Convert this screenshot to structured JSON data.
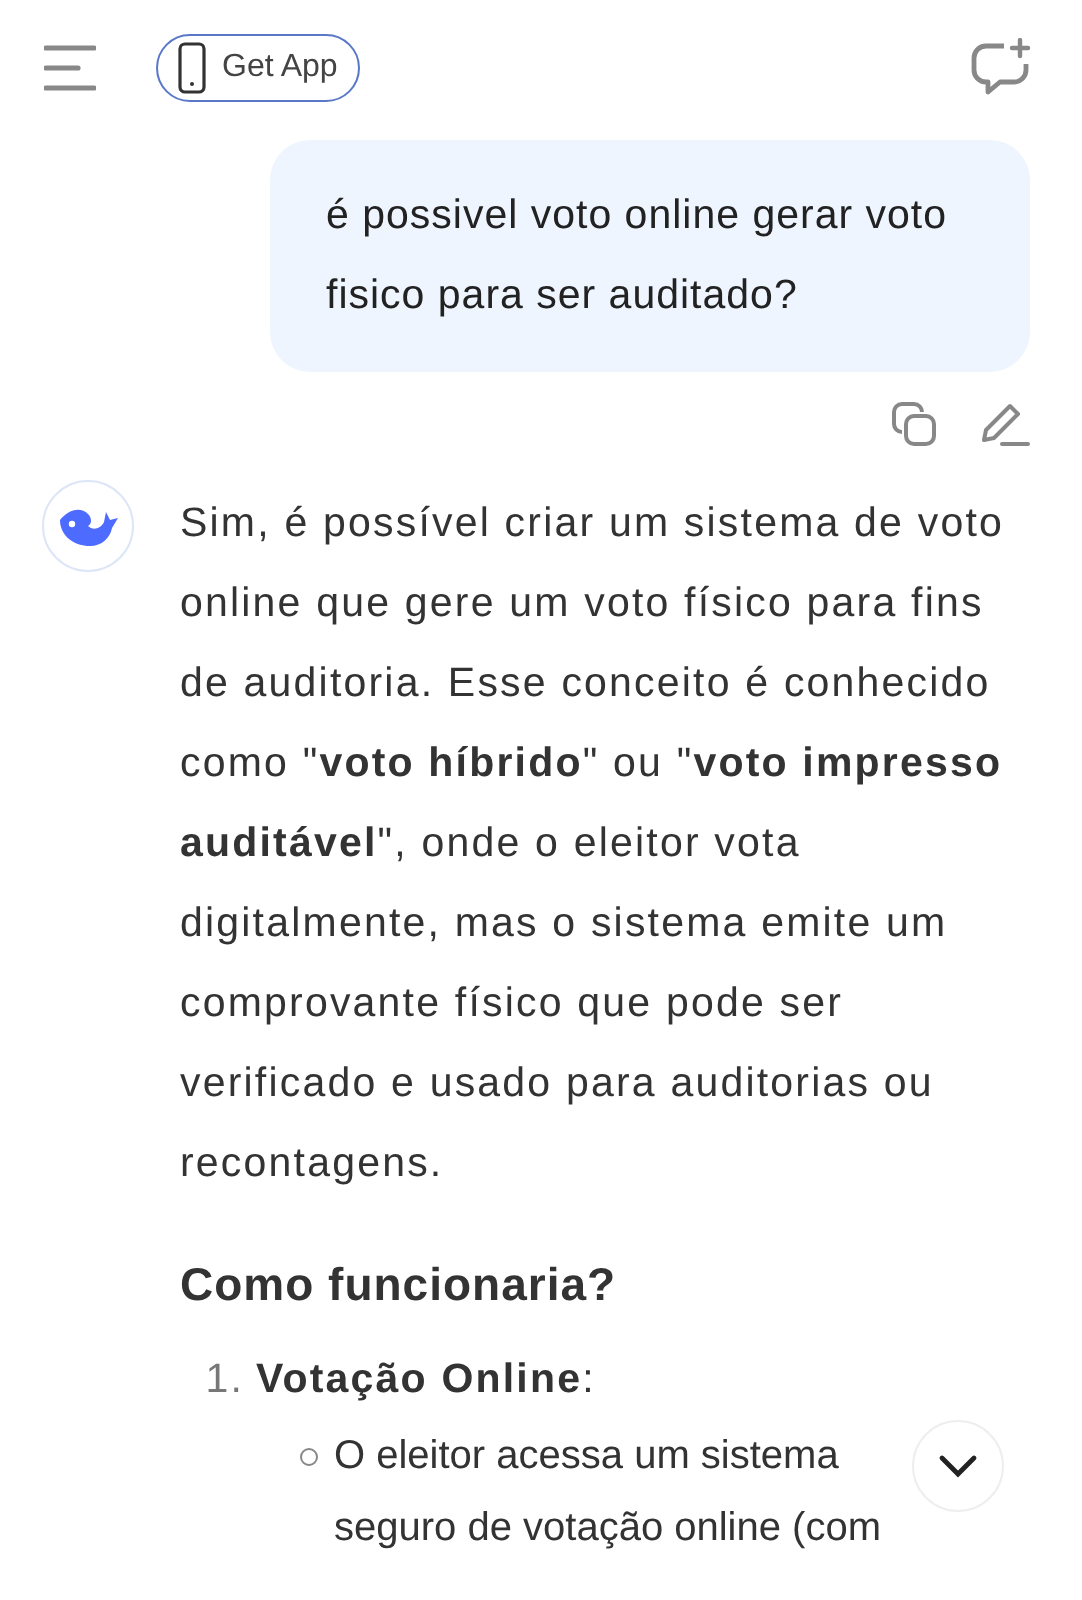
{
  "header": {
    "app_button": "Get App"
  },
  "user_message": {
    "text": "é possivel voto online gerar voto fisico para ser auditado?"
  },
  "assistant_message": {
    "paragraph": "Sim, é possível criar um sistema de voto online que gere um voto físico para fins de auditoria. Esse conceito é conhecido como \"**voto híbrido**\" ou \"**voto impresso auditável**\", onde o eleitor vota digitalmente, mas o sistema emite um comprovante físico que pode ser verificado e usado para auditorias ou recontagens.",
    "heading": "Como funcionaria?",
    "steps": [
      {
        "number": "1.",
        "title": "**Votação Online**:",
        "bullets": [
          "O eleitor acessa um sistema seguro de votação online (com"
        ]
      }
    ]
  }
}
